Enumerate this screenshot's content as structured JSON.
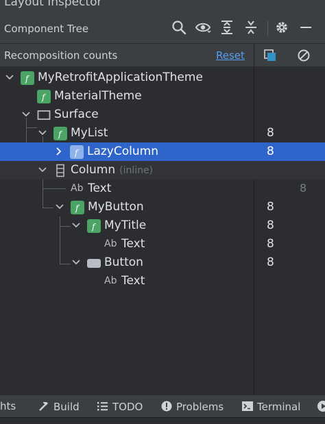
{
  "window": {
    "title": "Layout Inspector"
  },
  "toolbar": {
    "title": "Component Tree",
    "icons": [
      "search-icon",
      "eye-icon",
      "expand-all-icon",
      "collapse-all-icon",
      "gear-icon",
      "minimize-icon"
    ]
  },
  "recomposition": {
    "title": "Recomposition counts",
    "reset_label": "Reset",
    "columns": [
      "recomposition-count-icon",
      "skip-count-icon"
    ]
  },
  "tree": [
    {
      "label": "MyRetrofitApplicationTheme",
      "icon": "compose-function-icon",
      "expanded": true,
      "count": "",
      "skips": ""
    },
    {
      "label": "MaterialTheme",
      "icon": "compose-function-icon",
      "count": "",
      "skips": ""
    },
    {
      "label": "Surface",
      "icon": "surface-icon",
      "expanded": true,
      "count": "",
      "skips": ""
    },
    {
      "label": "MyList",
      "icon": "compose-function-icon",
      "expanded": true,
      "count": "8",
      "skips": ""
    },
    {
      "label": "LazyColumn",
      "icon": "compose-function-icon",
      "expanded": false,
      "selected": true,
      "count": "8",
      "skips": ""
    },
    {
      "label": "Column",
      "suffix": "(inline)",
      "icon": "column-icon",
      "expanded": true,
      "count": "",
      "skips": ""
    },
    {
      "label": "Text",
      "icon": "text-icon",
      "count": "",
      "skips": "8"
    },
    {
      "label": "MyButton",
      "icon": "compose-function-icon",
      "expanded": true,
      "count": "8",
      "skips": ""
    },
    {
      "label": "MyTitle",
      "icon": "compose-function-icon",
      "expanded": true,
      "count": "8",
      "skips": ""
    },
    {
      "label": "Text",
      "icon": "text-icon",
      "count": "8",
      "skips": ""
    },
    {
      "label": "Button",
      "icon": "button-icon",
      "expanded": true,
      "count": "8",
      "skips": ""
    },
    {
      "label": "Text",
      "icon": "text-icon",
      "count": "",
      "skips": ""
    }
  ],
  "bottom_tabs": [
    {
      "label": "hts",
      "icon": ""
    },
    {
      "label": "Build",
      "icon": "hammer-icon"
    },
    {
      "label": "TODO",
      "icon": "list-icon"
    },
    {
      "label": "Problems",
      "icon": "problems-icon"
    },
    {
      "label": "Terminal",
      "icon": "terminal-icon"
    },
    {
      "label": "",
      "icon": "play-icon"
    }
  ],
  "colors": {
    "background": "#2b2d30",
    "toolbar": "#3c3f41",
    "selection": "#2f65ca",
    "link": "#589df6",
    "compose_green": "#4aa564",
    "text": "#dfe1e5",
    "muted": "#7a7e85"
  }
}
